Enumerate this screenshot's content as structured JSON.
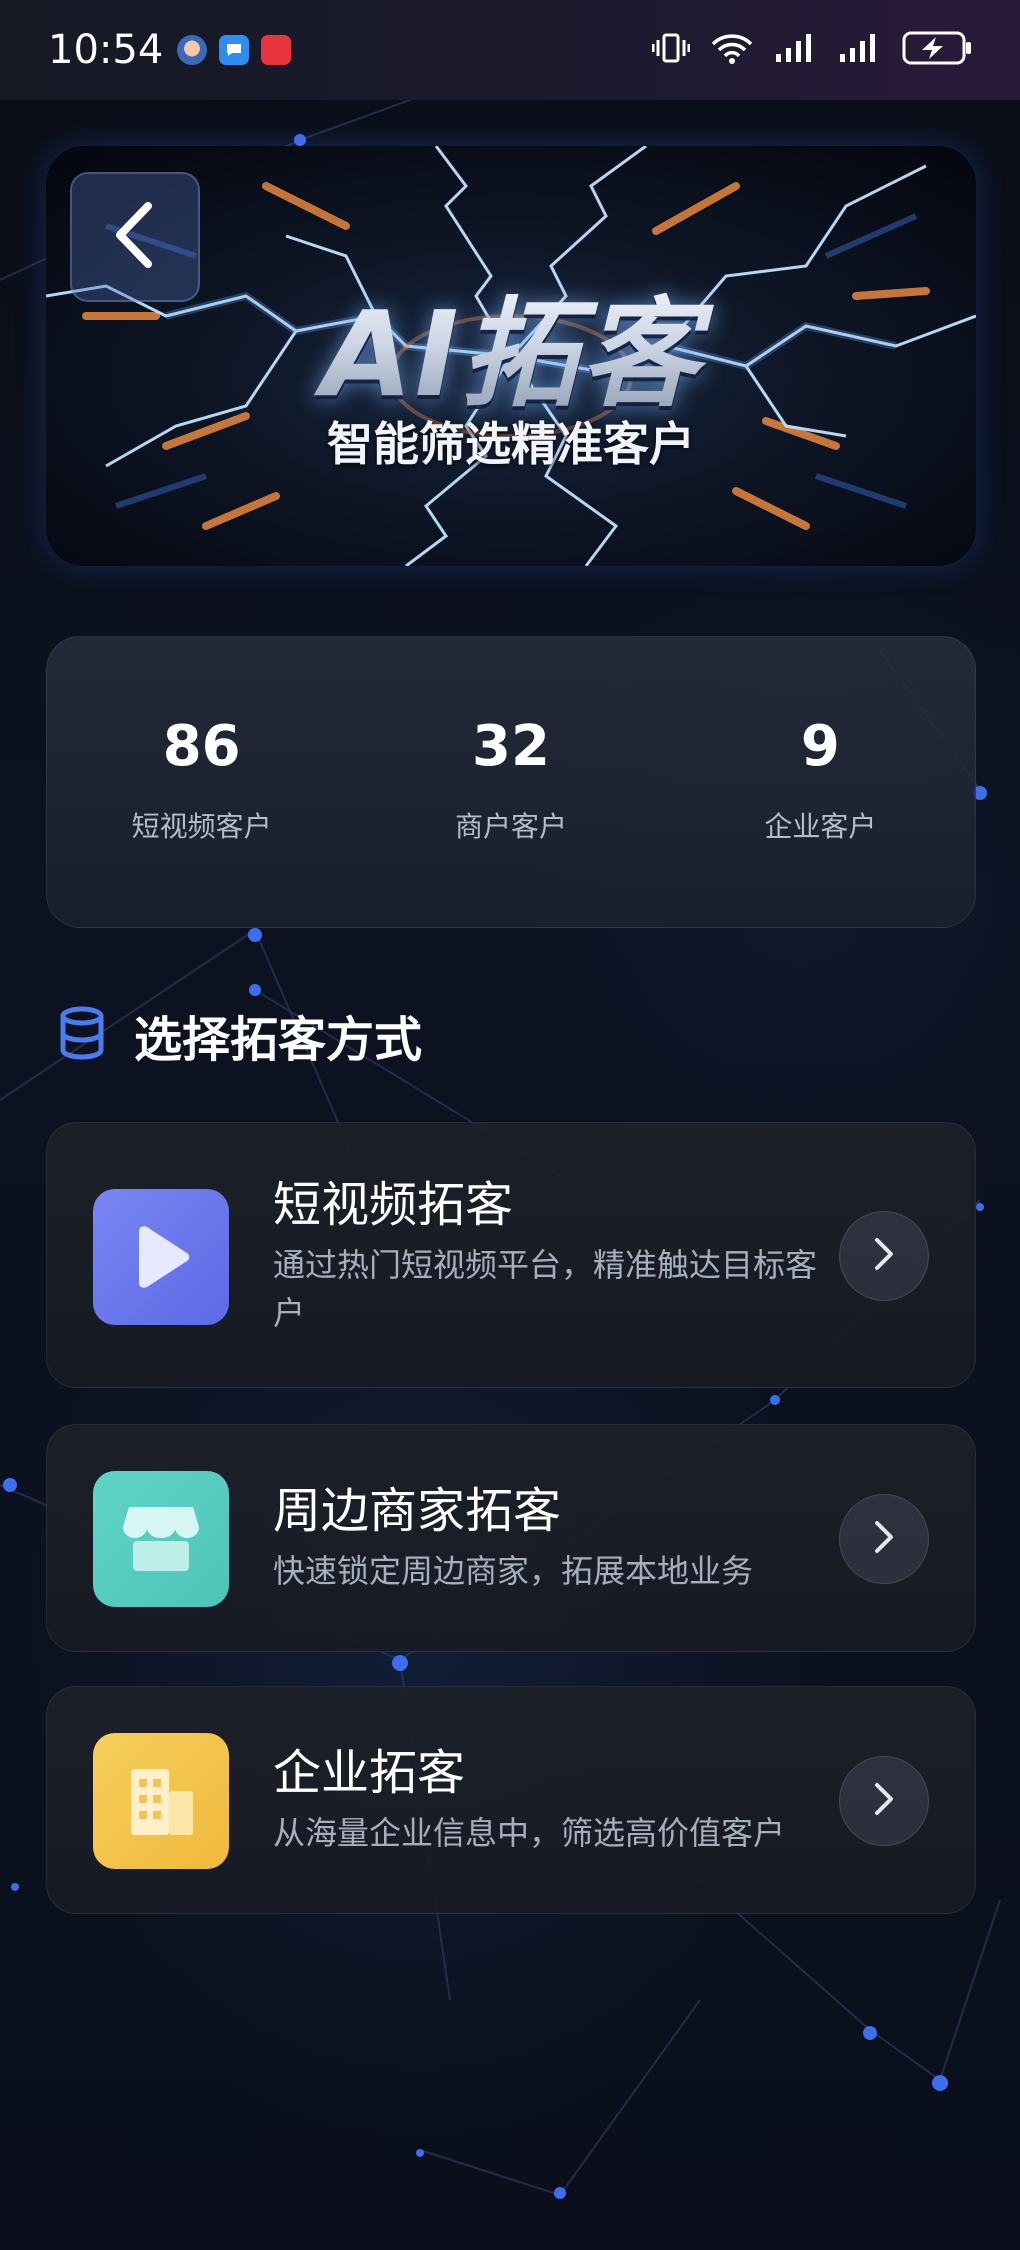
{
  "status_bar": {
    "time": "10:54",
    "notification_icons": [
      "avatar-app-icon",
      "message-app-icon",
      "red-app-icon"
    ],
    "system_icons": [
      "vibrate-icon",
      "wifi-icon",
      "signal-icon",
      "signal-icon",
      "battery-charging-icon"
    ]
  },
  "banner": {
    "title": "AI拓客",
    "subtitle": "智能筛选精准客户"
  },
  "stats": [
    {
      "value": "86",
      "label": "短视频客户"
    },
    {
      "value": "32",
      "label": "商户客户"
    },
    {
      "value": "9",
      "label": "企业客户"
    }
  ],
  "section": {
    "title": "选择拓客方式",
    "icon": "database-icon"
  },
  "methods": [
    {
      "title": "短视频拓客",
      "desc": "通过热门短视频平台，精准触达目标客户",
      "icon": "play-icon",
      "color": "#6d7cf0"
    },
    {
      "title": "周边商家拓客",
      "desc": "快速锁定周边商家，拓展本地业务",
      "icon": "store-icon",
      "color": "#5ed3c4"
    },
    {
      "title": "企业拓客",
      "desc": "从海量企业信息中，筛选高价值客户",
      "icon": "building-icon",
      "color": "#f5c44c"
    }
  ],
  "colors": {
    "accent_blue": "#4a7cf0",
    "background": "#0b0f18"
  }
}
